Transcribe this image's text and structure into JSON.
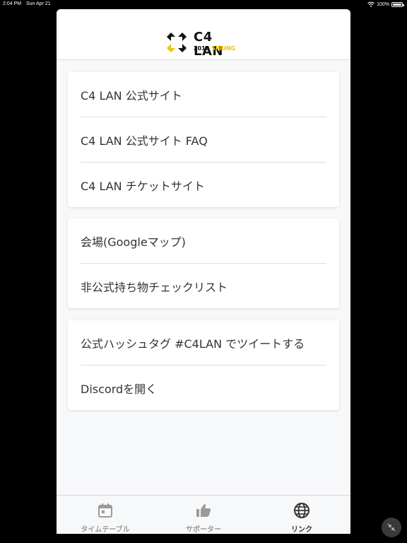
{
  "status": {
    "time": "2:04 PM",
    "date": "Sun Apr 21",
    "battery": "100%"
  },
  "header": {
    "logo_title": "C4 LAN",
    "logo_year": "2019",
    "logo_season": "SPRING"
  },
  "cards": [
    {
      "items": [
        {
          "label": "C4 LAN 公式サイト"
        },
        {
          "label": "C4 LAN 公式サイト FAQ"
        },
        {
          "label": "C4 LAN チケットサイト"
        }
      ]
    },
    {
      "items": [
        {
          "label": "会場(Googleマップ)"
        },
        {
          "label": "非公式持ち物チェックリスト"
        }
      ]
    },
    {
      "items": [
        {
          "label": "公式ハッシュタグ #C4LAN でツイートする"
        },
        {
          "label": "Discordを開く"
        }
      ]
    }
  ],
  "tabbar": {
    "tabs": [
      {
        "label": "タイムテーブル",
        "icon": "calendar-icon",
        "active": false
      },
      {
        "label": "サポーター",
        "icon": "thumbs-up-icon",
        "active": false
      },
      {
        "label": "リンク",
        "icon": "globe-icon",
        "active": true
      }
    ]
  },
  "colors": {
    "accent_yellow": "#f2c200",
    "active_tab": "#333333",
    "inactive_tab": "#9a9a9a"
  }
}
